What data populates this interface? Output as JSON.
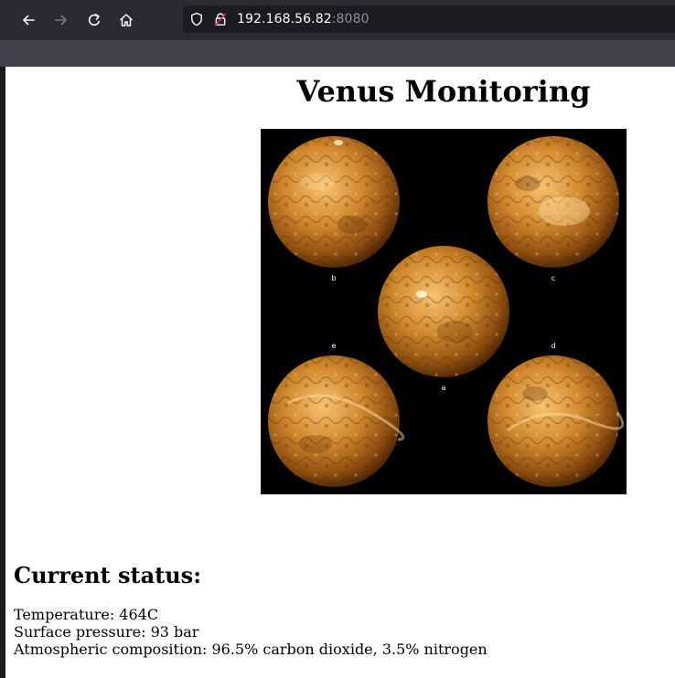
{
  "browser": {
    "url_host": "192.168.56.82",
    "url_port": ":8080",
    "icons": {
      "back": "back-arrow-icon",
      "forward": "forward-arrow-icon",
      "reload": "reload-icon",
      "home": "home-icon",
      "tracking": "shield-icon",
      "insecure": "insecure-lock-icon"
    }
  },
  "page": {
    "title": "Venus Monitoring",
    "figure": {
      "panel_labels": [
        "b",
        "c",
        "a",
        "e",
        "d"
      ]
    },
    "status": {
      "heading": "Current status:",
      "temperature": "Temperature: 464C",
      "pressure": "Surface pressure: 93 bar",
      "composition": "Atmospheric composition: 96.5% carbon dioxide, 3.5% nitrogen"
    }
  },
  "colors": {
    "chrome_bg": "#2b2a33",
    "urlbar_bg": "#1c1b22",
    "bookmarks_bg": "#42414d",
    "planet_light": "#f2b45a",
    "planet_dark": "#5a2a05"
  }
}
